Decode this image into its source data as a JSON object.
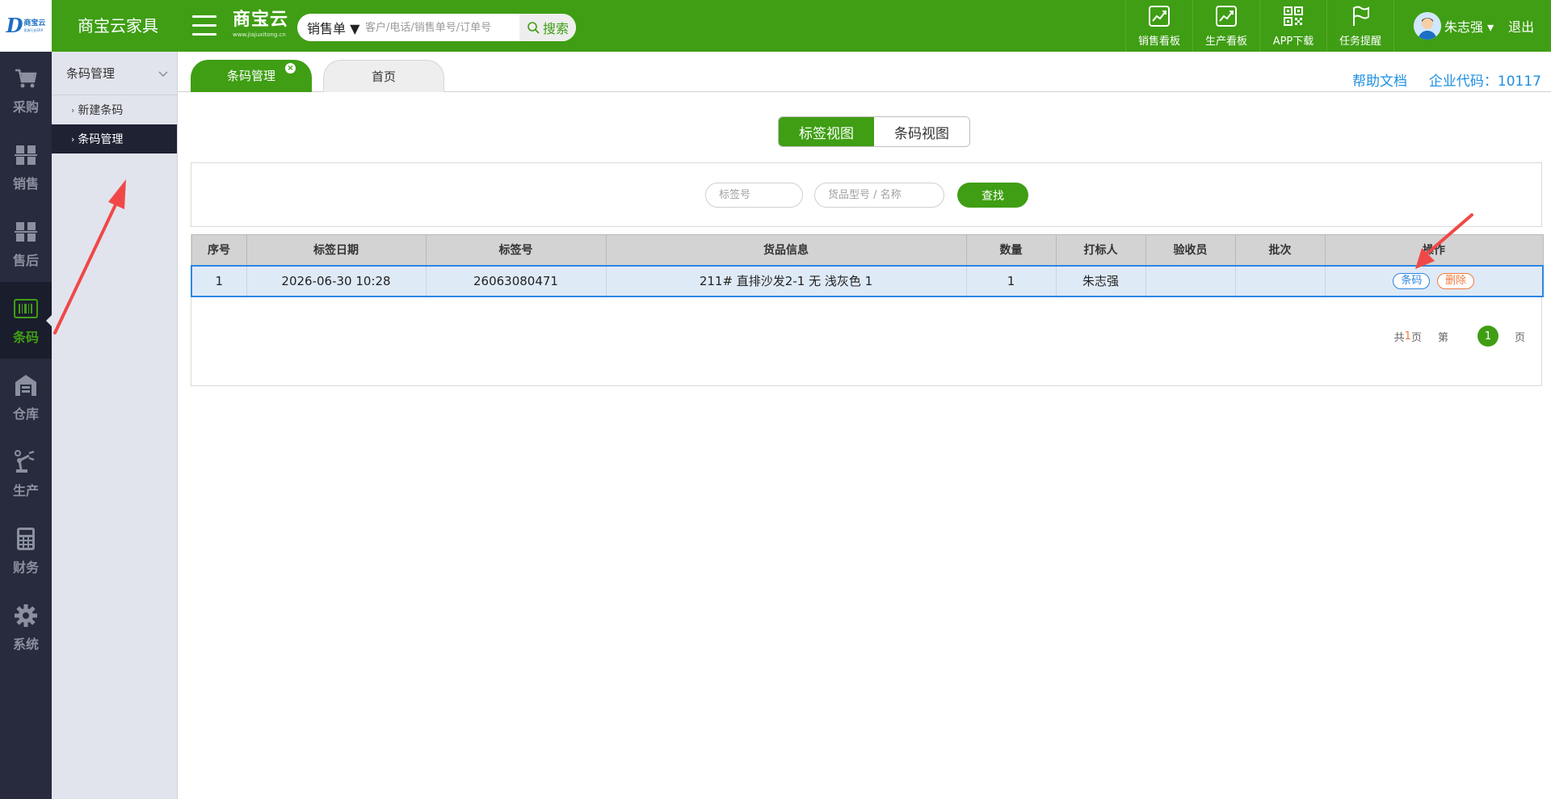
{
  "logo": {
    "mark": "D",
    "name": "商宝云",
    "tagline": "家具行业ERP"
  },
  "app_title": "商宝云家具",
  "brand": {
    "name": "商宝云",
    "url": "www.jiajuxitong.cn"
  },
  "search": {
    "type_label": "销售单 ▼",
    "placeholder": "客户/电话/销售单号/订单号",
    "button_label": "搜索"
  },
  "top_nav": [
    {
      "label": "销售看板",
      "icon": "chart-icon"
    },
    {
      "label": "生产看板",
      "icon": "chart-icon"
    },
    {
      "label": "APP下载",
      "icon": "qr-code-icon"
    },
    {
      "label": "任务提醒",
      "icon": "flag-icon"
    }
  ],
  "user": {
    "name": "朱志强 ▾",
    "logout": "退出"
  },
  "sidebar": {
    "items": [
      {
        "label": "采购",
        "icon": "cart-icon"
      },
      {
        "label": "销售",
        "icon": "boxes-icon"
      },
      {
        "label": "售后",
        "icon": "boxes-icon"
      },
      {
        "label": "条码",
        "icon": "barcode-icon",
        "active": true
      },
      {
        "label": "仓库",
        "icon": "warehouse-icon"
      },
      {
        "label": "生产",
        "icon": "robot-arm-icon"
      },
      {
        "label": "财务",
        "icon": "calculator-icon"
      },
      {
        "label": "系统",
        "icon": "gear-icon"
      }
    ]
  },
  "submenu": {
    "title": "条码管理",
    "links": [
      {
        "label": "新建条码"
      },
      {
        "label": "条码管理",
        "active": true
      }
    ]
  },
  "tabs": [
    {
      "label": "条码管理",
      "active": true,
      "close": "×"
    },
    {
      "label": "首页",
      "active": false
    }
  ],
  "header_links": {
    "help": "帮助文档",
    "corp_code": "企业代码：10117"
  },
  "view_toggle": {
    "tag_view": "标签视图",
    "barcode_view": "条码视图",
    "selected": "标签视图"
  },
  "filters": {
    "tag_placeholder": "标签号",
    "goods_placeholder": "货品型号 / 名称",
    "find_label": "查找"
  },
  "table": {
    "headers": [
      "序号",
      "标签日期",
      "标签号",
      "货品信息",
      "数量",
      "打标人",
      "验收员",
      "批次",
      "操作"
    ],
    "rows": [
      {
        "no": "1",
        "date": "2026-06-30 10:28",
        "tag_no": "26063080471",
        "goods": "211# 直排沙发2-1 无 浅灰色 1",
        "qty": "1",
        "labeler": "朱志强",
        "inspector": "",
        "batch": "",
        "actions": {
          "barcode": "条码",
          "delete": "删除"
        }
      }
    ]
  },
  "pager": {
    "total_prefix": "共",
    "total_pages": "1",
    "total_suffix": "页",
    "page_prefix": "第",
    "current": "1",
    "page_suffix": "页"
  },
  "colors": {
    "brand_green": "#3f9e14",
    "sidebar_dark": "#272b3d",
    "link_blue": "#1f8fe0",
    "annotation_red": "#f04848"
  }
}
